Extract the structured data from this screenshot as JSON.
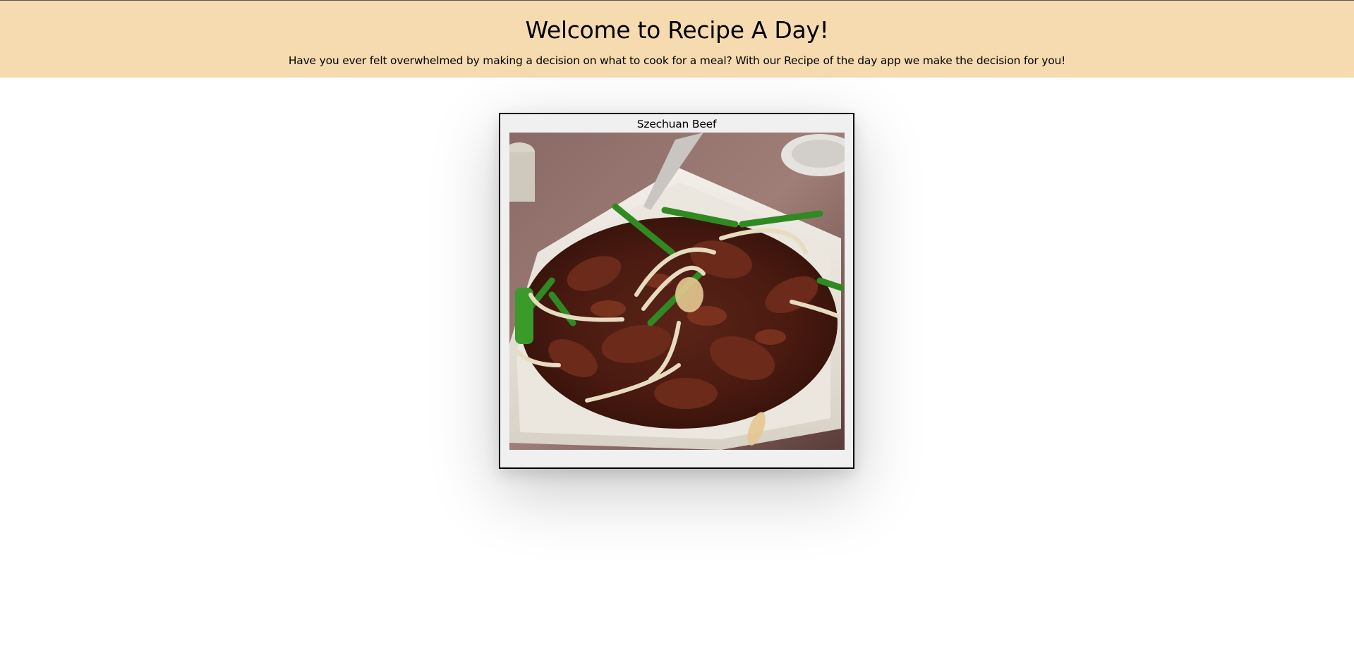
{
  "header": {
    "title": "Welcome to Recipe A Day!",
    "subtitle": "Have you ever felt overwhelmed by making a decision on what to cook for a meal? With our Recipe of the day app we make the decision for you!"
  },
  "recipe": {
    "name": "Szechuan Beef",
    "image_alt": "photo of szechuan beef stir fry with green onions and onion on a white plate"
  },
  "colors": {
    "header_background": "#f5dbaf",
    "card_background": "#f0f0f0"
  }
}
